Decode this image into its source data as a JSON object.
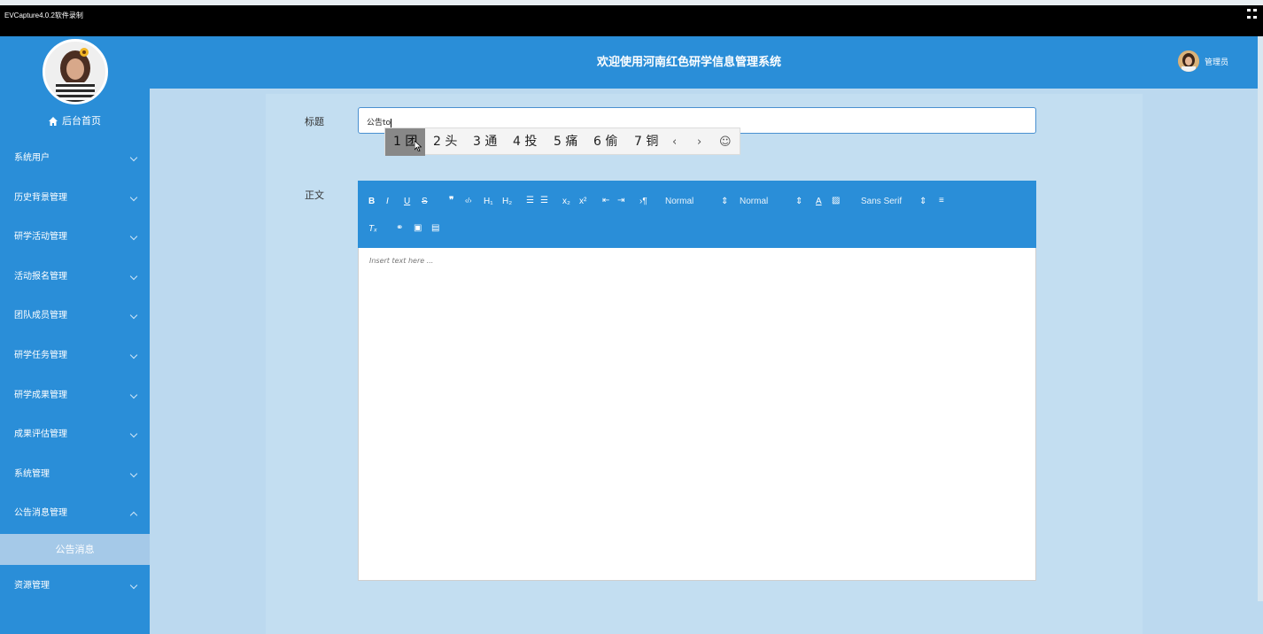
{
  "capture_bar": {
    "caption": "EVCapture4.0.2软件录制"
  },
  "sidebar": {
    "home_label": "后台首页",
    "items": [
      {
        "label": "系统用户"
      },
      {
        "label": "历史背景管理"
      },
      {
        "label": "研学活动管理"
      },
      {
        "label": "活动报名管理"
      },
      {
        "label": "团队成员管理"
      },
      {
        "label": "研学任务管理"
      },
      {
        "label": "研学成果管理"
      },
      {
        "label": "成果评估管理"
      },
      {
        "label": "系统管理"
      },
      {
        "label": "公告消息管理",
        "expanded": true
      }
    ],
    "sub_item": "公告消息",
    "last_item": "资源管理"
  },
  "header": {
    "title": "欢迎使用河南红色研学信息管理系统",
    "admin_label": "管理员"
  },
  "form": {
    "title_label": "标题",
    "title_value": "公告to",
    "body_label": "正文",
    "placeholder": "Insert text here ..."
  },
  "ime": {
    "candidates": [
      "1 团",
      "2 头",
      "3 通",
      "4 投",
      "5 痛",
      "6 偷",
      "7 铜"
    ],
    "selected_index": 0
  },
  "toolbar": {
    "header_select": "Normal",
    "size_select": "Normal",
    "font_select": "Sans Serif"
  },
  "colors": {
    "primary": "#2a8ed8",
    "background": "#bcd9ef",
    "submenu_active": "#a5c9e8"
  }
}
